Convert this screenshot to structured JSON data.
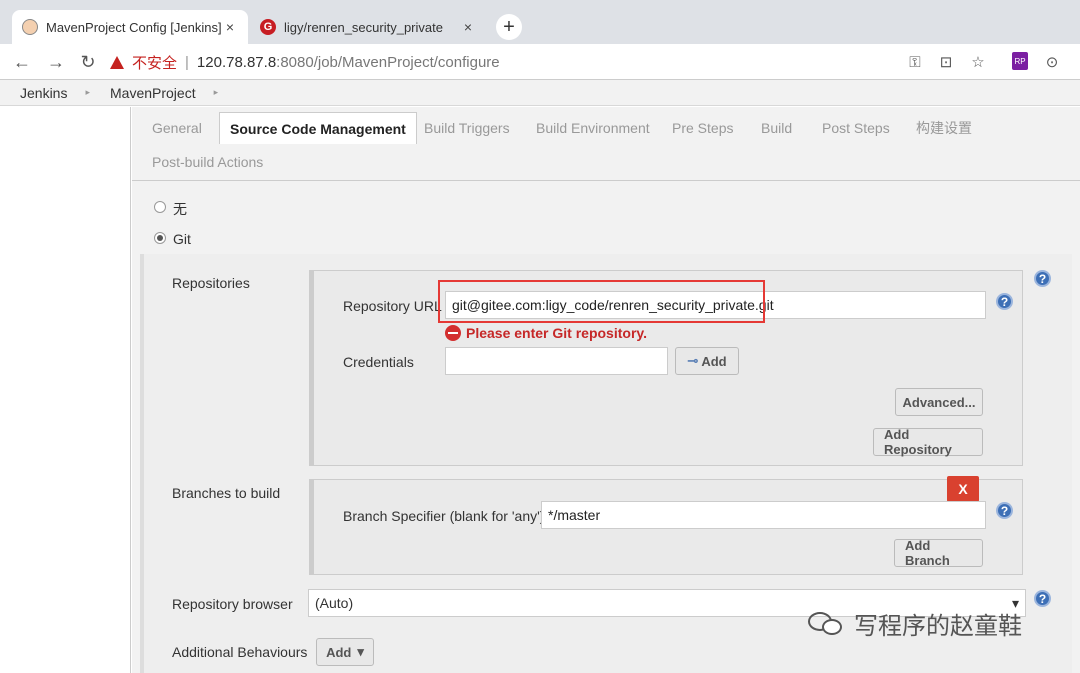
{
  "browser": {
    "tabs": [
      {
        "title": "MavenProject Config [Jenkins]",
        "close": "×",
        "active": true,
        "favicon": "jenkins-logo-icon"
      },
      {
        "title": "ligy/renren_security_private",
        "close": "×",
        "active": false,
        "favicon": "gitee-logo-icon",
        "favicon_glyph": "G"
      }
    ],
    "new_tab": "+",
    "nav": {
      "back": "←",
      "forward": "→",
      "reload": "↻"
    },
    "security_label": "不安全",
    "url_separator": "|",
    "url_host": "120.78.87.8",
    "url_rest": ":8080/job/MavenProject/configure",
    "toolbar_icons": {
      "key": "⚿",
      "translate": "⊡",
      "star": "☆",
      "rp": "RP",
      "ext": "⊙"
    }
  },
  "breadcrumb": {
    "items": [
      "Jenkins",
      "MavenProject"
    ],
    "arrow": "▸"
  },
  "config_tabs": {
    "active": "Source Code Management",
    "items": [
      "General",
      "Source Code Management",
      "Build Triggers",
      "Build Environment",
      "Pre Steps",
      "Build",
      "Post Steps",
      "构建设置",
      "Post-build Actions"
    ]
  },
  "scm": {
    "options": [
      {
        "label": "无",
        "selected": false
      },
      {
        "label": "Git",
        "selected": true
      }
    ],
    "repositories": {
      "section_label": "Repositories",
      "url_label": "Repository URL",
      "url_value": "git@gitee.com:ligy_code/renren_security_private.git",
      "error": "Please enter Git repository.",
      "credentials_label": "Credentials",
      "credentials_value": "",
      "add_button": "Add",
      "advanced_button": "Advanced...",
      "add_repository_button": "Add Repository"
    },
    "branches": {
      "section_label": "Branches to build",
      "delete_button": "X",
      "specifier_label": "Branch Specifier (blank for 'any')",
      "specifier_value": "*/master",
      "add_branch_button": "Add Branch"
    },
    "repository_browser": {
      "label": "Repository browser",
      "selected": "(Auto)",
      "arrow": "▾"
    },
    "additional_behaviours": {
      "label": "Additional Behaviours",
      "add_button": "Add",
      "arrow": "▾"
    },
    "help_glyph": "?"
  },
  "watermark": {
    "text": "写程序的赵童鞋",
    "icon": "wechat-icon"
  },
  "colors": {
    "error": "#c62828",
    "highlight": "#e53935",
    "delete": "#d9412f",
    "help": "#3d6fb6"
  }
}
